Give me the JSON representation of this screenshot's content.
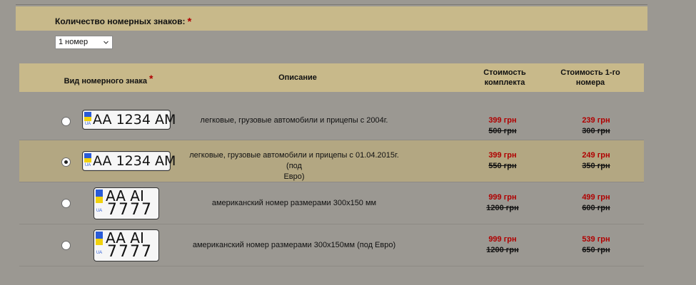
{
  "quantity": {
    "label": "Количество номерных знаков:",
    "required_mark": "*",
    "selected": "1 номер"
  },
  "table": {
    "headers": {
      "type": "Вид номерного знака",
      "required_mark": "*",
      "description": "Описание",
      "set_cost_line1": "Стоимость",
      "set_cost_line2": "комплекта",
      "first_cost_line1": "Стоимость 1-го",
      "first_cost_line2": "номера"
    },
    "rows": [
      {
        "plate_style": "wide",
        "plate_line1": "AA 1234 AM",
        "flag_text": "UA",
        "description_line1": "легковые, грузовые автомобили и прицепы с 2004г.",
        "description_line2": "",
        "set_price": "399 грн",
        "set_old_price": "500 грн",
        "first_price": "239 грн",
        "first_old_price": "300 грн",
        "selected": false
      },
      {
        "plate_style": "wide",
        "plate_line1": "AA 1234 AM",
        "flag_text": "UA",
        "description_line1": "легковые, грузовые автомобили и прицепы с 01.04.2015г. (под",
        "description_line2": "Евро)",
        "set_price": "399 грн",
        "set_old_price": "550 грн",
        "first_price": "249 грн",
        "first_old_price": "350 грн",
        "selected": true
      },
      {
        "plate_style": "square",
        "plate_line1": "AA  AI",
        "plate_line2": "7777",
        "flag_text": "UA",
        "description_line1": "американский номер размерами 300x150 мм",
        "description_line2": "",
        "set_price": "999 грн",
        "set_old_price": "1200 грн",
        "first_price": "499 грн",
        "first_old_price": "600 грн",
        "selected": false
      },
      {
        "plate_style": "square",
        "plate_line1": "AA  AI",
        "plate_line2": "7777",
        "flag_text": "UA",
        "description_line1": "американский номер размерами 300x150мм (под Евро)",
        "description_line2": "",
        "set_price": "999 грн",
        "set_old_price": "1200 грн",
        "first_price": "539 грн",
        "first_old_price": "650 грн",
        "selected": false
      }
    ]
  },
  "colors": {
    "background": "#9b9892",
    "header_bar": "#c8b98a",
    "selected_row": "#b3a782",
    "price_red": "#b00000"
  }
}
